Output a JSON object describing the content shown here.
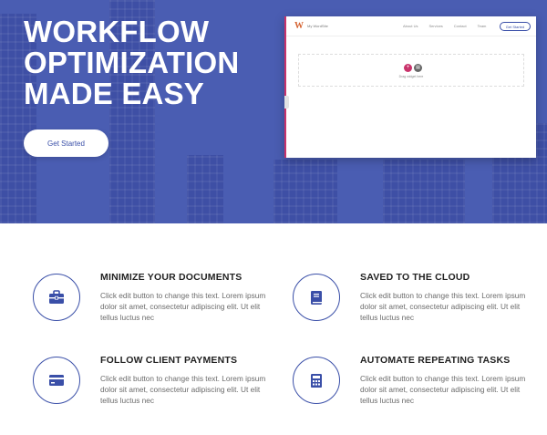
{
  "hero": {
    "title_lines": [
      "WORKFLOW",
      "OPTIMIZATION",
      "MADE EASY"
    ],
    "cta_label": "Get Started"
  },
  "preview": {
    "logo_letter": "W",
    "brand": "My WordSite",
    "nav_links": [
      "About Us",
      "Services",
      "Contact",
      "Team"
    ],
    "cta_label": "Get Started",
    "add_glyph": "+",
    "folder_glyph": "▤",
    "drop_text": "Drag widget here"
  },
  "features": [
    {
      "title": "MINIMIZE YOUR DOCUMENTS",
      "text": "Click edit button to change this text. Lorem ipsum dolor sit amet, consectetur adipiscing elit. Ut elit tellus luctus nec",
      "icon": "briefcase-icon"
    },
    {
      "title": "SAVED TO THE CLOUD",
      "text": "Click edit button to change this text. Lorem ipsum dolor sit amet, consectetur adipiscing elit. Ut elit tellus luctus nec",
      "icon": "book-icon"
    },
    {
      "title": "FOLLOW CLIENT PAYMENTS",
      "text": "Click edit button to change this text. Lorem ipsum dolor sit amet, consectetur adipiscing elit. Ut elit tellus luctus nec",
      "icon": "credit-card-icon"
    },
    {
      "title": "AUTOMATE REPEATING TASKS",
      "text": "Click edit button to change this text. Lorem ipsum dolor sit amet, consectetur adipiscing elit. Ut elit tellus luctus nec",
      "icon": "calculator-icon"
    }
  ],
  "colors": {
    "hero_bg": "#4a5db2",
    "accent": "#3a4fa8",
    "pink": "#c9336b"
  }
}
